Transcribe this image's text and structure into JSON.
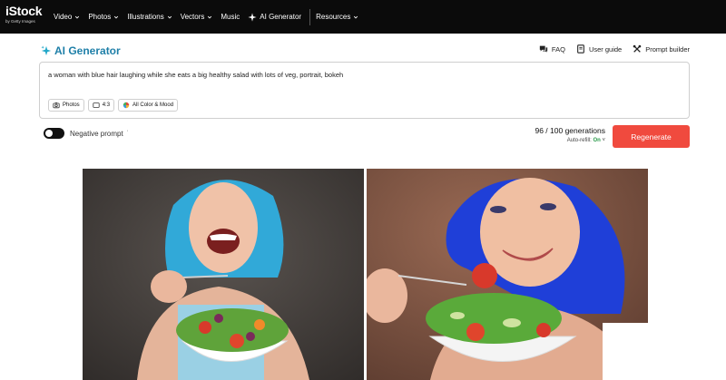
{
  "brand": {
    "name": "iStock",
    "tagline": "by Getty Images"
  },
  "nav": {
    "items": [
      "Video",
      "Photos",
      "Illustrations",
      "Vectors",
      "Music"
    ],
    "ai_generator": "AI Generator",
    "resources": "Resources"
  },
  "generator": {
    "title": "AI Generator",
    "tools": {
      "faq": "FAQ",
      "user_guide": "User guide",
      "prompt_builder": "Prompt builder"
    }
  },
  "prompt": {
    "text": "a woman with blue hair laughing while she eats a big healthy salad with lots of veg, portrait, bokeh",
    "chips": [
      "Photos",
      "4:3",
      "All Color & Mood"
    ]
  },
  "controls": {
    "negative_prompt": "Negative prompt",
    "negative_enabled": false,
    "generations": "96 / 100 generations",
    "auto_refill_label": "Auto-refill:",
    "auto_refill_value": "On",
    "regenerate": "Regenerate"
  },
  "results": {
    "images": [
      "image-result-1",
      "image-result-2"
    ],
    "colors": {
      "hair_light": "#31a9d8",
      "hair_dark": "#1f3fd8",
      "bg_left": "#4a4542",
      "bg_right": "#8a5a46"
    }
  },
  "colors": {
    "nav_bg": "#0b0b0b",
    "accent": "#1e7fa8",
    "regenerate_bg": "#f04a3e",
    "refill_on": "#2a9a4a"
  }
}
